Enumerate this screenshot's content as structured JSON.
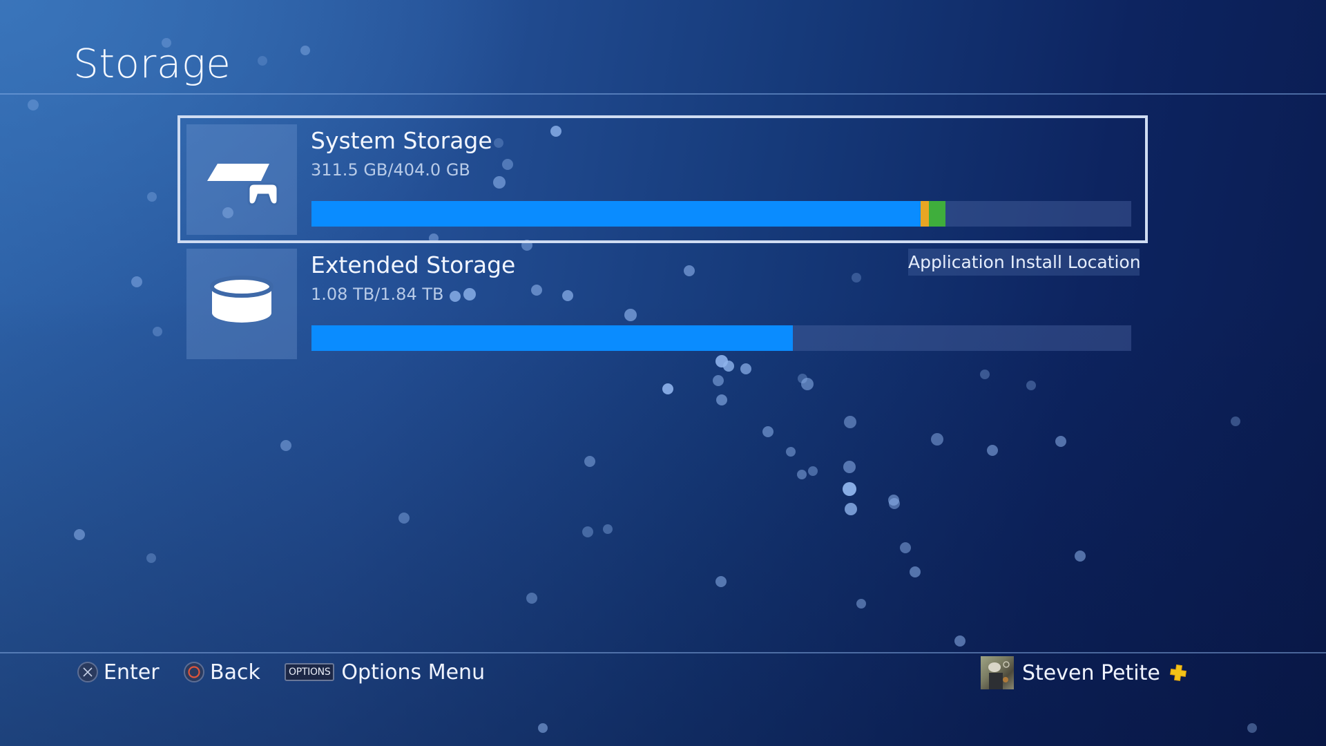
{
  "header": {
    "title": "Storage"
  },
  "storage_items": [
    {
      "name": "System Storage",
      "icon": "console-controller-icon",
      "usage_text": "311.5 GB/404.0 GB",
      "used": 311.5,
      "total": 404.0,
      "unit": "GB",
      "selected": true,
      "segments": [
        {
          "category": "applications",
          "fraction": 0.743,
          "color": "#0a8cff"
        },
        {
          "category": "other-1",
          "fraction": 0.01,
          "color": "#e8a623"
        },
        {
          "category": "other-2",
          "fraction": 0.02,
          "color": "#3fae3c"
        }
      ],
      "tag": "Application Install Location"
    },
    {
      "name": "Extended Storage",
      "icon": "external-drive-icon",
      "usage_text": "1.08 TB/1.84 TB",
      "used": 1.08,
      "total": 1.84,
      "unit": "TB",
      "selected": false,
      "segments": [
        {
          "category": "applications",
          "fraction": 0.587,
          "color": "#0a8cff"
        }
      ]
    }
  ],
  "footer": {
    "hints": [
      {
        "button": "cross",
        "label": "Enter"
      },
      {
        "button": "circle",
        "label": "Back"
      },
      {
        "button": "options",
        "button_text": "OPTIONS",
        "label": "Options Menu"
      }
    ],
    "user": {
      "name": "Steven Petite",
      "badge": "playstation-plus-icon",
      "badge_color": "#f2c318"
    }
  },
  "colors": {
    "accent_blue": "#0a8cff",
    "frame": "#cfdcf2",
    "circle_button": "#e0553a"
  }
}
